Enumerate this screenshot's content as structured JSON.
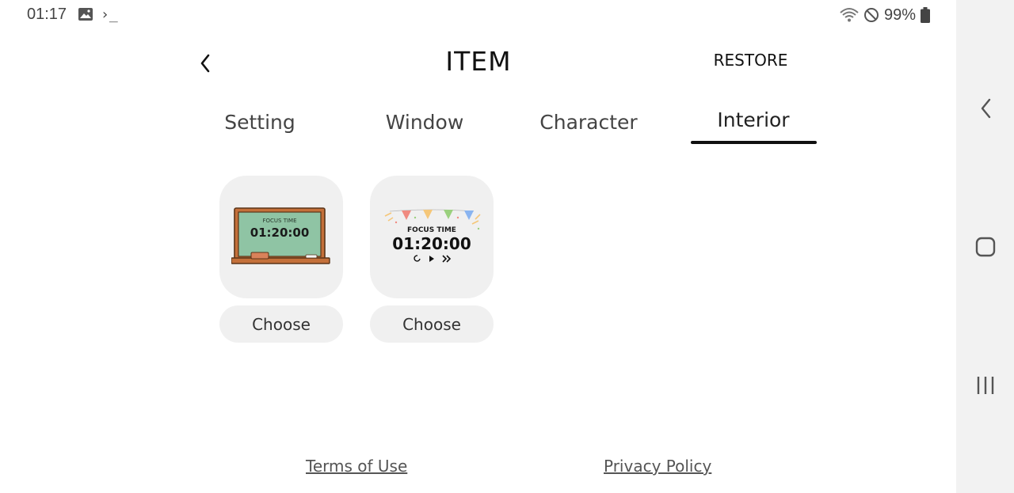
{
  "status_bar": {
    "time": "01:17",
    "terminal_glyph": "›_",
    "battery_percent": "99%",
    "icons": [
      "image-icon",
      "terminal-icon",
      "wifi-icon",
      "do-not-disturb-icon",
      "battery-icon"
    ]
  },
  "header": {
    "back_icon": "chevron-left-icon",
    "title": "ITEM",
    "restore_label": "RESTORE"
  },
  "tabs": [
    {
      "label": "Setting",
      "active": false
    },
    {
      "label": "Window",
      "active": false
    },
    {
      "label": "Character",
      "active": false
    },
    {
      "label": "Interior",
      "active": true
    }
  ],
  "items": [
    {
      "style": "chalkboard",
      "caption": "FOCUS TIME",
      "time": "01:20:00",
      "choose_label": "Choose"
    },
    {
      "style": "party-bunting",
      "caption": "FOCUS TIME",
      "time": "01:20:00",
      "choose_label": "Choose"
    }
  ],
  "footer": {
    "terms_label": "Terms of Use",
    "privacy_label": "Privacy Policy"
  },
  "nav_bar": {
    "icons": [
      "back-nav-icon",
      "home-nav-icon",
      "recents-nav-icon"
    ]
  },
  "colors": {
    "chalkboard_green": "#8fc4a4",
    "chalkboard_frame": "#c4703a",
    "card_background": "#f0f0f0",
    "nav_background": "#f2f2f2",
    "bunting_red": "#f08a80",
    "bunting_yellow": "#f5c77a",
    "bunting_green": "#9ad07e",
    "bunting_blue": "#8ab4f0"
  }
}
